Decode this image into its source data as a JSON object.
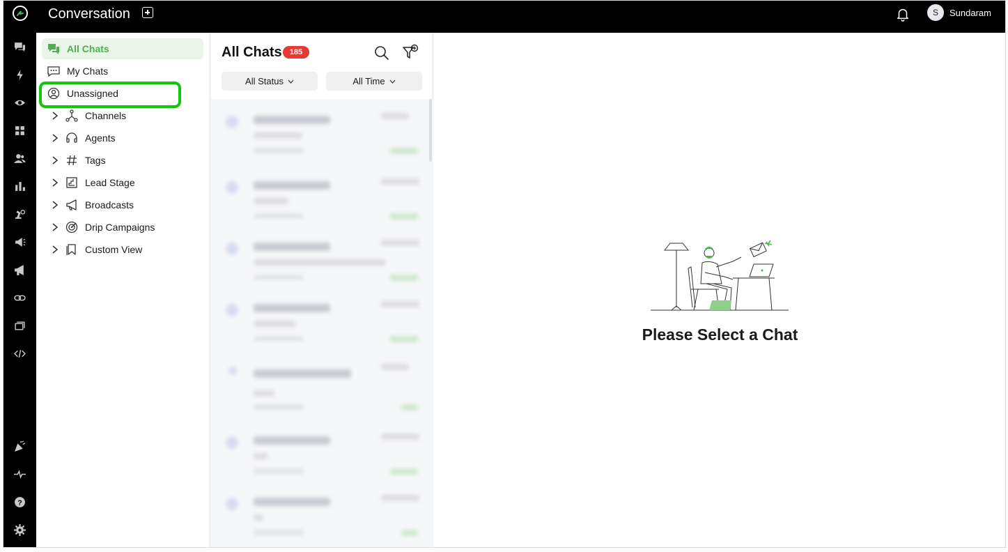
{
  "topbar": {
    "app_title": "Conversation",
    "user_initial": "S",
    "user_name": "Sundaram"
  },
  "rail": {
    "icons": [
      "chat-icon",
      "flash-icon",
      "eye-icon",
      "dashboard-icon",
      "contacts-icon",
      "reports-icon",
      "automation-icon",
      "campaign-icon",
      "broadcast-icon",
      "link-icon",
      "templates-icon",
      "code-icon",
      "whats-new-icon",
      "activity-icon",
      "help-icon",
      "settings-icon"
    ]
  },
  "nav": {
    "items": [
      {
        "label": "All Chats",
        "icon": "chats-icon",
        "active": true
      },
      {
        "label": "My Chats",
        "icon": "my-chats-icon"
      },
      {
        "label": "Unassigned",
        "icon": "unassigned-icon"
      },
      {
        "label": "Channels",
        "icon": "channels-icon"
      },
      {
        "label": "Agents",
        "icon": "headset-icon"
      },
      {
        "label": "Tags",
        "icon": "hashtag-icon"
      },
      {
        "label": "Lead Stage",
        "icon": "lead-stage-icon"
      },
      {
        "label": "Broadcasts",
        "icon": "megaphone-icon"
      },
      {
        "label": "Drip Campaigns",
        "icon": "target-icon"
      },
      {
        "label": "Custom View",
        "icon": "bookmark-icon"
      }
    ]
  },
  "list": {
    "title": "All Chats",
    "count": "185",
    "status_filter": "All Status",
    "time_filter": "All Time"
  },
  "main": {
    "empty_message": "Please Select a Chat"
  },
  "colors": {
    "accent": "#4caf50",
    "badge": "#e53935",
    "highlight": "#12c70a",
    "topbar": "#000000"
  }
}
